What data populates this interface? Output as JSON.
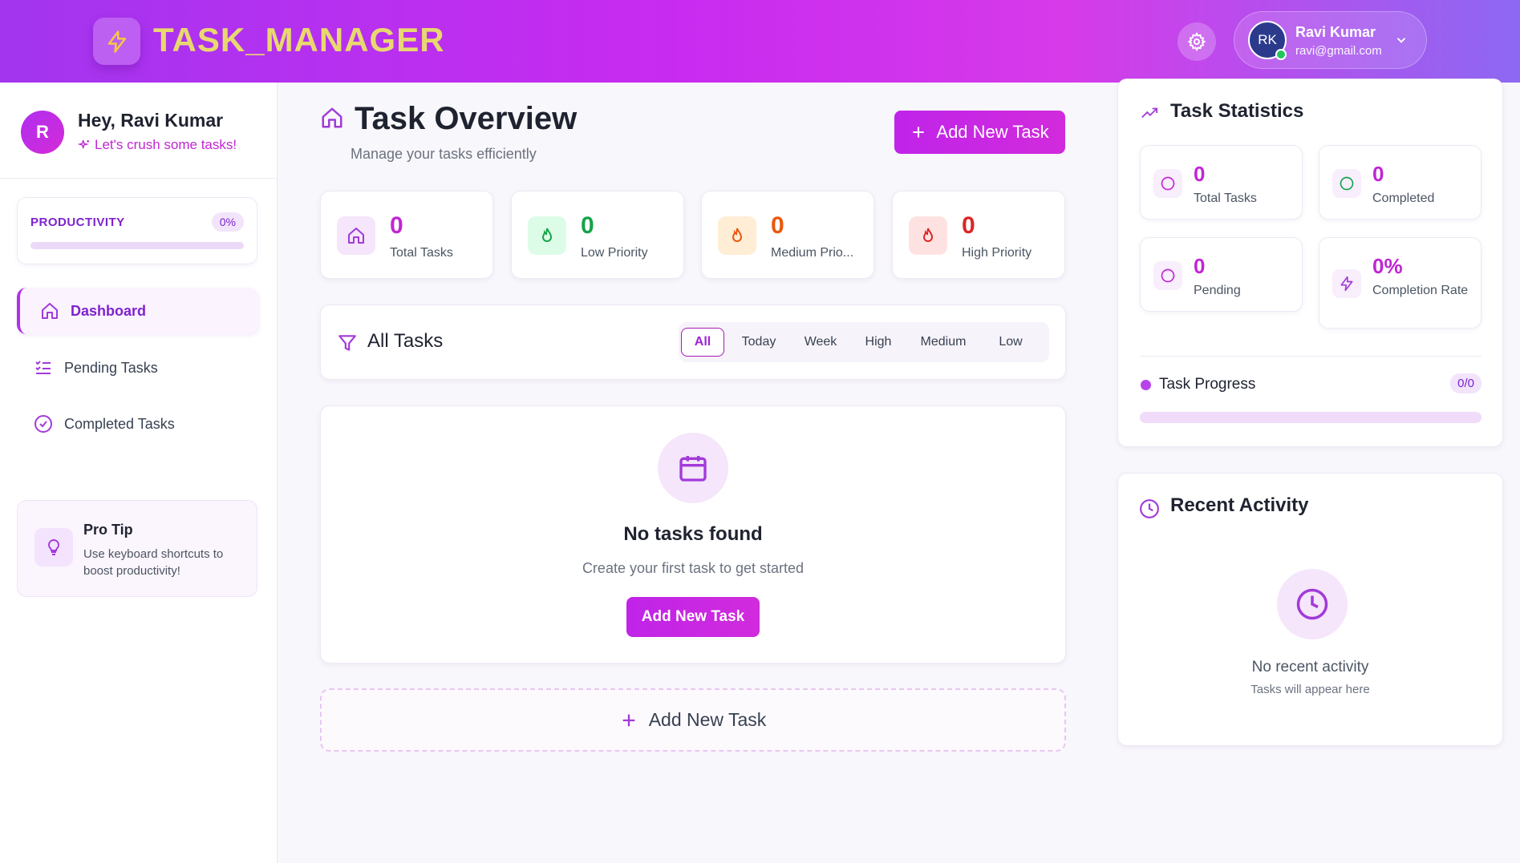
{
  "header": {
    "app_title": "TASK_MANAGER",
    "user": {
      "initials": "RK",
      "name": "Ravi Kumar",
      "email": "ravi@gmail.com"
    }
  },
  "sidebar": {
    "avatar_initial": "R",
    "greeting": "Hey, Ravi Kumar",
    "tagline": "Let's crush some tasks!",
    "productivity": {
      "label": "PRODUCTIVITY",
      "percent_text": "0%",
      "progress": 0
    },
    "nav": [
      {
        "label": "Dashboard",
        "icon": "home-icon",
        "active": true
      },
      {
        "label": "Pending Tasks",
        "icon": "list-check-icon",
        "active": false
      },
      {
        "label": "Completed Tasks",
        "icon": "check-circle-icon",
        "active": false
      }
    ],
    "pro_tip": {
      "title": "Pro Tip",
      "text": "Use keyboard shortcuts to boost productivity!"
    }
  },
  "main": {
    "title": "Task Overview",
    "subtitle": "Manage your tasks efficiently",
    "add_button": "Add New Task",
    "stats": [
      {
        "value": "0",
        "label": "Total Tasks",
        "icon": "home-icon",
        "color": "#c026d3",
        "bg": "#f5e6fb",
        "icon_color": "#a23ad9"
      },
      {
        "value": "0",
        "label": "Low Priority",
        "icon": "flame-icon",
        "color": "#16a34a",
        "bg": "#dcfce7",
        "icon_color": "#16a34a"
      },
      {
        "value": "0",
        "label": "Medium Prio...",
        "icon": "flame-icon",
        "color": "#ea580c",
        "bg": "#ffedd5",
        "icon_color": "#ea580c"
      },
      {
        "value": "0",
        "label": "High Priority",
        "icon": "flame-icon",
        "color": "#dc2626",
        "bg": "#fee2e2",
        "icon_color": "#dc2626"
      }
    ],
    "filter": {
      "title": "All Tasks",
      "tabs": [
        "All",
        "Today",
        "Week",
        "High",
        "Medium",
        "Low"
      ],
      "active": "All"
    },
    "empty": {
      "title": "No tasks found",
      "subtitle": "Create your first task to get started",
      "button": "Add New Task"
    },
    "add_dashed": "Add New Task"
  },
  "statistics": {
    "title": "Task Statistics",
    "cards": [
      {
        "value": "0",
        "label": "Total Tasks",
        "icon": "circle-icon",
        "icon_color": "#c026d3"
      },
      {
        "value": "0",
        "label": "Completed",
        "icon": "circle-icon",
        "icon_color": "#16a34a"
      },
      {
        "value": "0",
        "label": "Pending",
        "icon": "circle-icon",
        "icon_color": "#c026d3"
      },
      {
        "value": "0%",
        "label": "Completion Rate",
        "icon": "lightning-icon",
        "icon_color": "#a23ad9"
      }
    ],
    "progress": {
      "label": "Task Progress",
      "count": "0/0",
      "fraction": 0
    }
  },
  "activity": {
    "title": "Recent Activity",
    "empty_title": "No recent activity",
    "empty_sub": "Tasks will appear here"
  },
  "colors": {
    "accent": "#c026d3",
    "brand_purple": "#7e22ce"
  }
}
